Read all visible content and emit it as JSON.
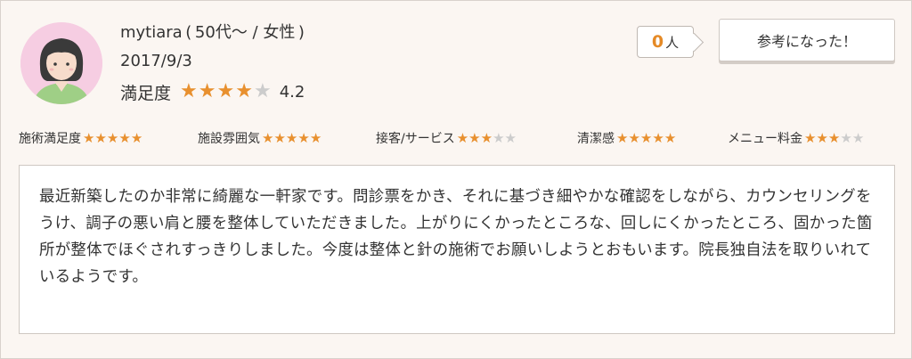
{
  "reviewer": {
    "name_line": "mytiara ( 50代〜 / 女性 )",
    "date": "2017/9/3",
    "satisfaction_label": "満足度",
    "satisfaction_value": "4.2",
    "satisfaction_stars": 4
  },
  "helpful": {
    "count": "0",
    "unit": "人",
    "button_label": "参考になった！"
  },
  "categories": [
    {
      "label": "施術満足度",
      "stars": 5
    },
    {
      "label": "施設雰囲気",
      "stars": 5
    },
    {
      "label": "接客/サービス",
      "stars": 3
    },
    {
      "label": "清潔感",
      "stars": 5
    },
    {
      "label": "メニュー料金",
      "stars": 3
    }
  ],
  "comment": "最近新築したのか非常に綺麗な一軒家です。問診票をかき、それに基づき細やかな確認をしながら、カウンセリングをうけ、調子の悪い肩と腰を整体していただきました。上がりにくかったところな、回しにくかったところ、固かった箇所が整体でほぐされすっきりしました。今度は整体と針の施術でお願いしようとおもいます。院長独自法を取りいれているようです。",
  "colors": {
    "star_filled": "#e8902f",
    "star_empty": "#cccccc",
    "avatar_bg": "#f6cde2",
    "count_accent": "#e58a26",
    "card_bg": "#fbf6f2"
  },
  "icons": {
    "avatar": "female-avatar-icon",
    "star": "star-icon"
  }
}
